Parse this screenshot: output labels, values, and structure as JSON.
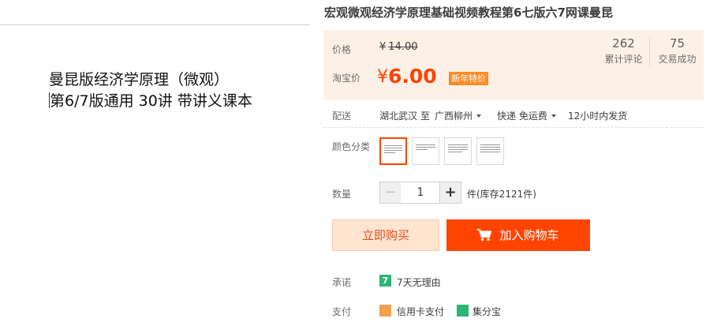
{
  "cover": {
    "line1": "曼昆版经济学原理（微观）",
    "line2": "第6/7版通用 30讲 带讲义课本"
  },
  "product": {
    "title": "宏观微观经济学原理基础视频教程第6七版六7网课曼昆"
  },
  "price": {
    "label": "价格",
    "currency": "¥",
    "original": "14.00",
    "taobao_label": "淘宝价",
    "current": "6.00",
    "badge": "新年特价",
    "accent_color": "#ff4400"
  },
  "stats": {
    "reviews_value": "262",
    "reviews_label": "累计评论",
    "sales_value": "75",
    "sales_label": "交易成功"
  },
  "shipping": {
    "label": "配送",
    "from": "湖北武汉 至",
    "to": "广西柳州",
    "method": "快递 免运费",
    "dispatch": "12小时内发货"
  },
  "options": {
    "label": "颜色分类",
    "swatch_icons": [
      "document-thumbnail",
      "document-thumbnail",
      "document-thumbnail",
      "document-thumbnail"
    ]
  },
  "quantity": {
    "label": "数量",
    "minus": "−",
    "value": "1",
    "plus": "+",
    "stock": "件(库存2121件)"
  },
  "actions": {
    "buy_now": "立即购买",
    "add_to_cart": "加入购物车",
    "cart_icon": "cart-icon"
  },
  "promise": {
    "label": "承诺",
    "icon_text": "7",
    "text": "7天无理由"
  },
  "payment": {
    "label": "支付",
    "method1": "信用卡支付",
    "method2": "集分宝"
  }
}
